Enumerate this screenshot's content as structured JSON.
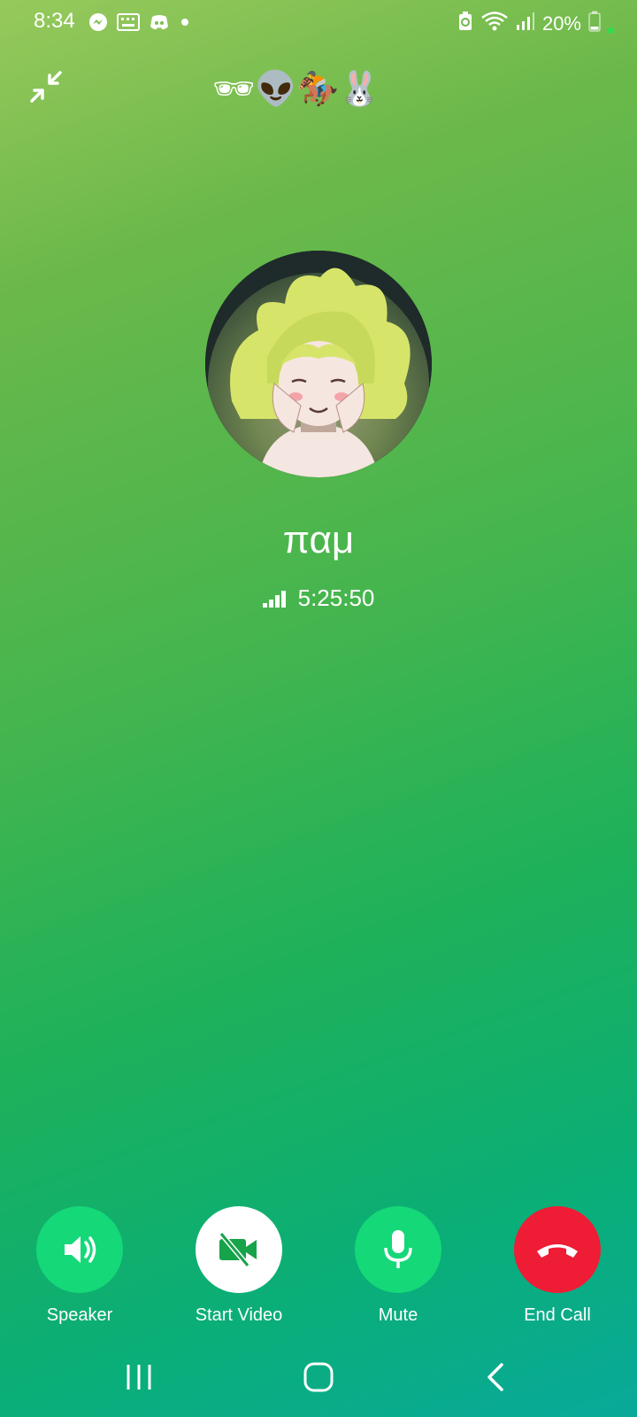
{
  "status_bar": {
    "time": "8:34",
    "battery_percent": "20%",
    "icons_left": [
      "messenger-icon",
      "keyboard-icon",
      "discord-icon",
      "dot-icon"
    ],
    "icons_right": [
      "battery-saver-icon",
      "wifi-icon",
      "signal-icon",
      "battery-icon"
    ]
  },
  "call_header": {
    "emoji_key": "🕶👽🏇🐰"
  },
  "contact": {
    "name": "παμ",
    "call_duration": "5:25:50"
  },
  "controls": {
    "speaker_label": "Speaker",
    "video_label": "Start Video",
    "mute_label": "Mute",
    "end_label": "End Call"
  },
  "colors": {
    "accent_green": "#15d878",
    "end_call_red": "#ee1c34"
  }
}
